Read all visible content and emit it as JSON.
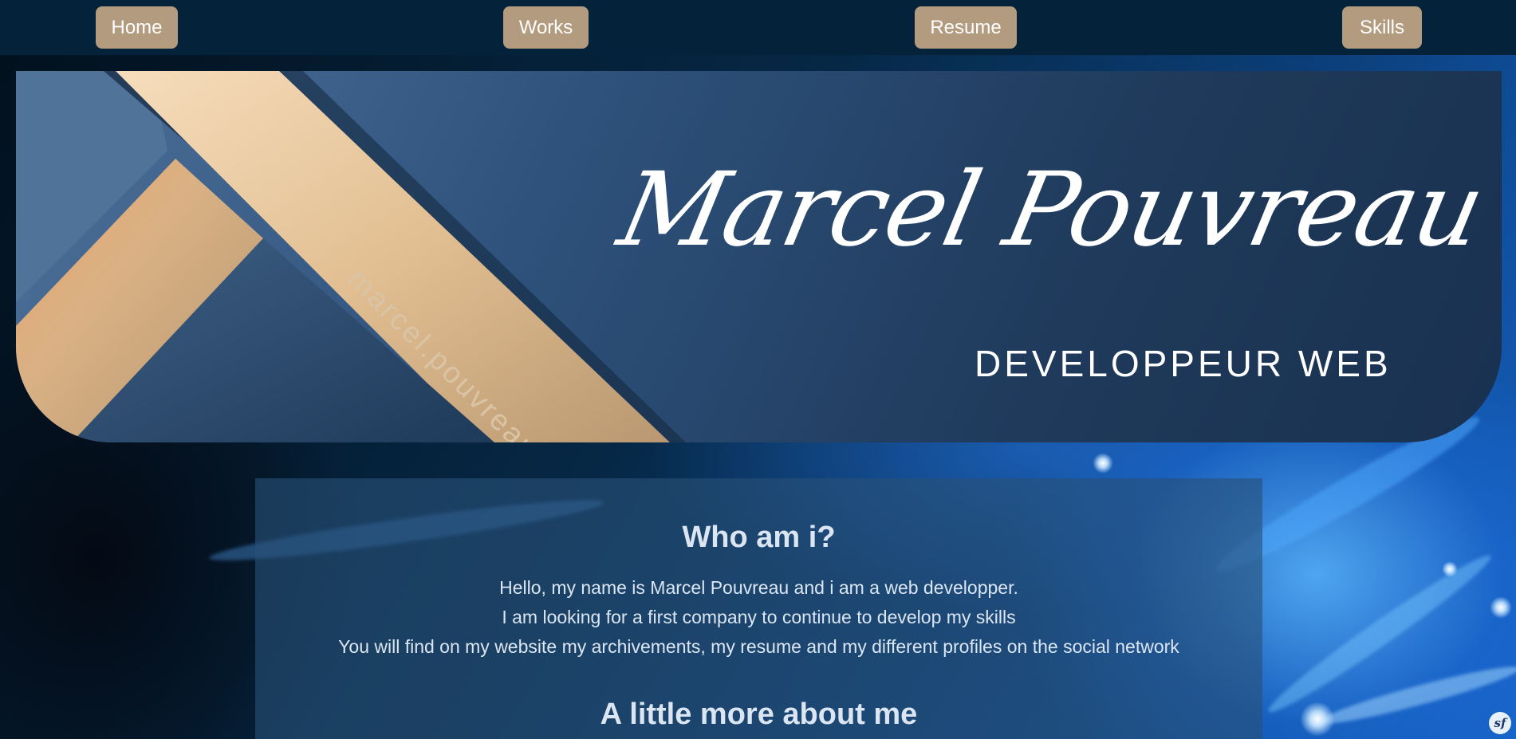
{
  "nav": {
    "items": [
      {
        "label": "Home"
      },
      {
        "label": "Works"
      },
      {
        "label": "Resume"
      },
      {
        "label": "Skills"
      }
    ]
  },
  "banner": {
    "email": "marcel.pouvreau@gmail.com",
    "name": "Marcel Pouvreau",
    "subtitle": "DEVELOPPEUR WEB"
  },
  "about": {
    "title": "Who am i?",
    "lines": [
      "Hello, my name is Marcel Pouvreau and i am a web developper.",
      "I am looking for a first company to continue to develop my skills",
      "You will find on my website my archivements, my resume and my different profiles on the social network"
    ],
    "more_title": "A little more about me"
  },
  "toolbar_badge": {
    "icon": "symfony-icon",
    "text": "sf"
  },
  "colors": {
    "nav_bg": "#04223a",
    "nav_button": "#b39b7f",
    "accent_gold": "#d9c4a6",
    "panel_text": "#dbe6f2"
  }
}
